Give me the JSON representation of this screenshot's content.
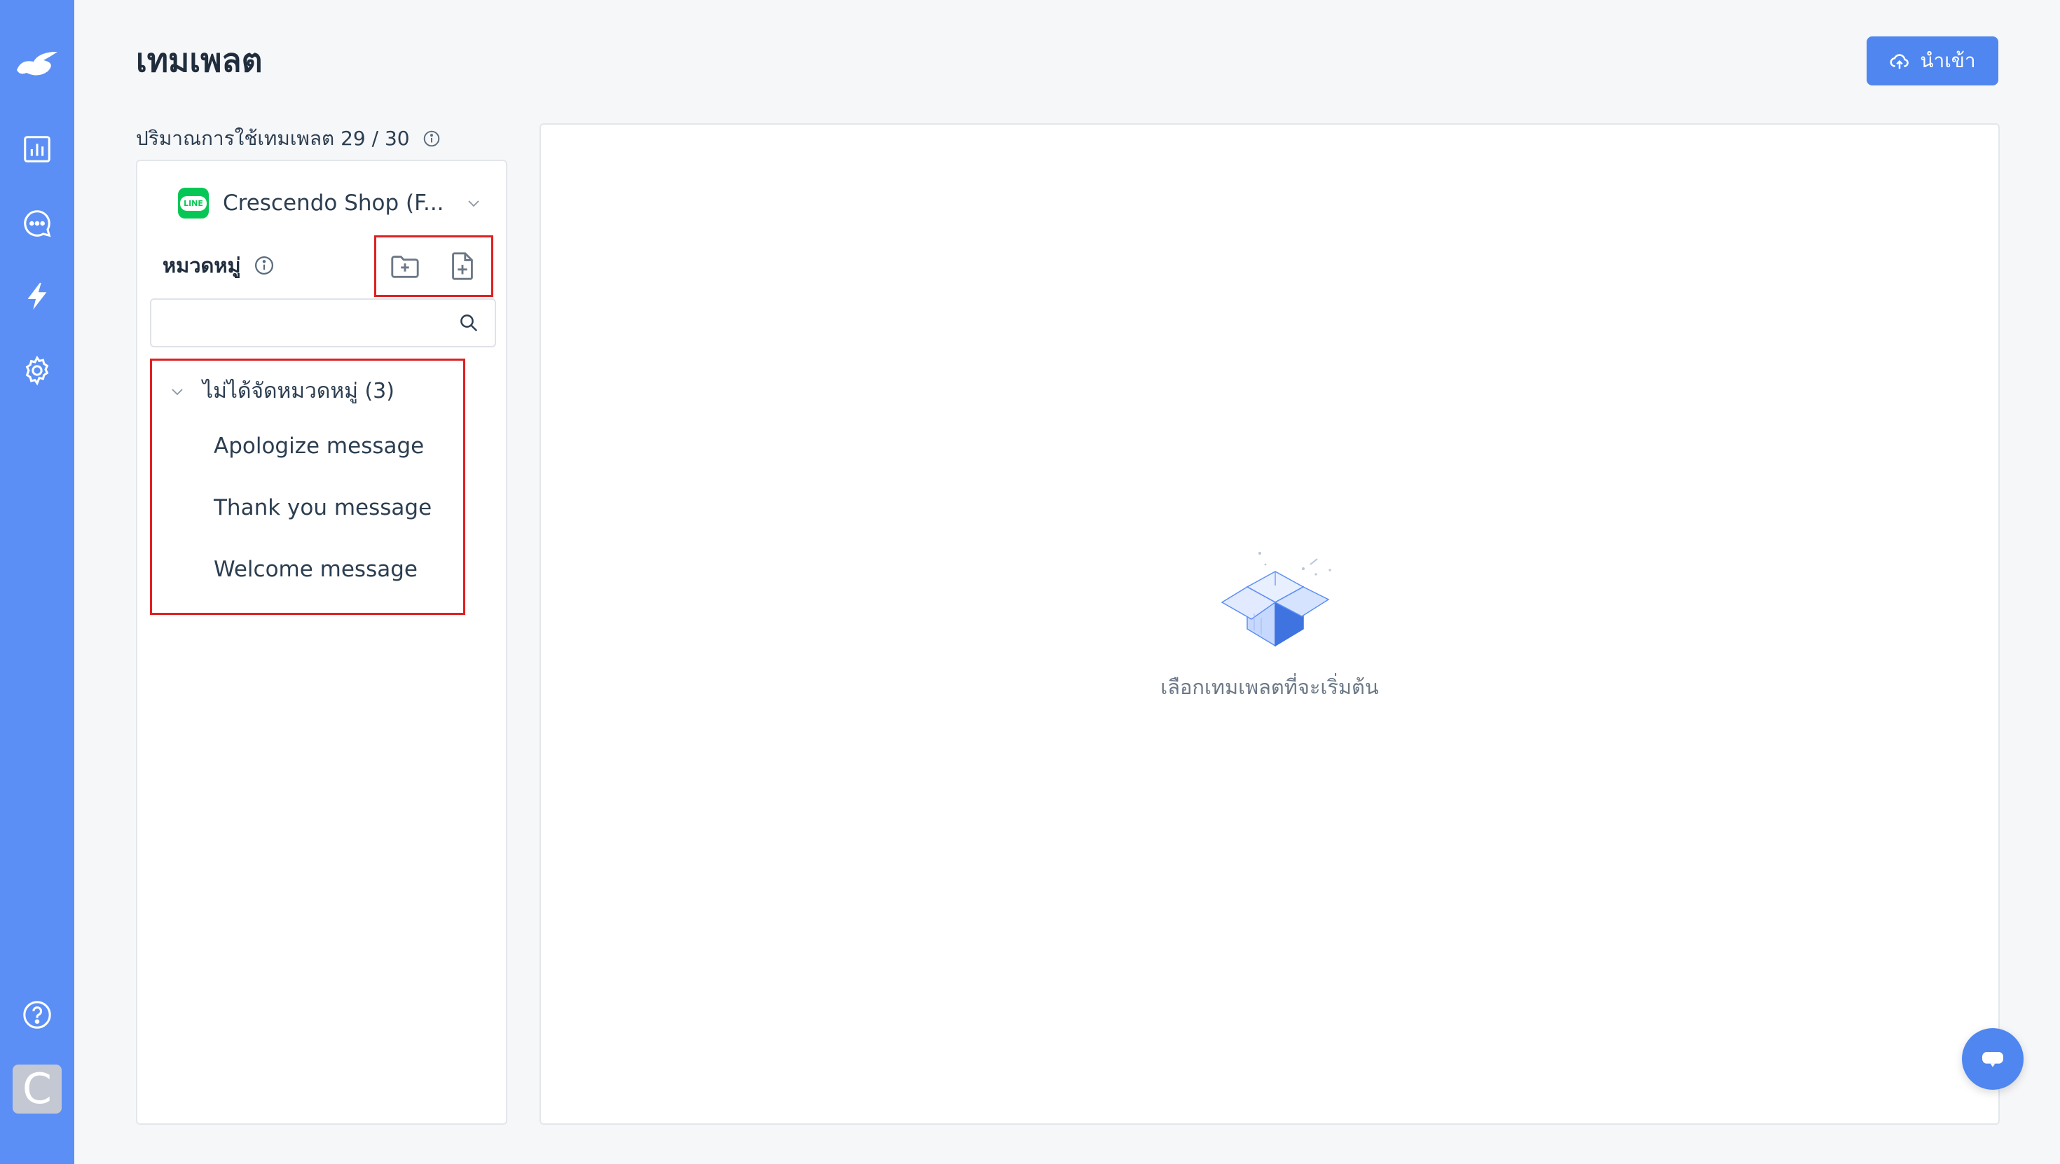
{
  "page": {
    "title": "เทมเพลต",
    "import_label": "นำเข้า",
    "usage_label": "ปริมาณการใช้เทมเพลต 29 / 30"
  },
  "sidebar_nav": {
    "icons": [
      "logo-icon",
      "analytics-icon",
      "chat-icon",
      "lightning-icon",
      "settings-icon",
      "help-icon"
    ],
    "avatar_letter": "C"
  },
  "left_panel": {
    "channel_name": "Crescendo Shop (F...",
    "channel_badge": "LINE",
    "category_label": "หมวดหมู่",
    "search_placeholder": "",
    "tree": {
      "group_label": "ไม่ได้จัดหมวดหมู่ (3)",
      "items": [
        "Apologize message",
        "Thank you message",
        "Welcome message"
      ]
    }
  },
  "main_panel": {
    "empty_text": "เลือกเทมเพลตที่จะเริ่มต้น"
  },
  "colors": {
    "rail": "#5b8ff5",
    "primary": "#4f86ef",
    "highlight": "#e02020",
    "line_green": "#06c755"
  }
}
